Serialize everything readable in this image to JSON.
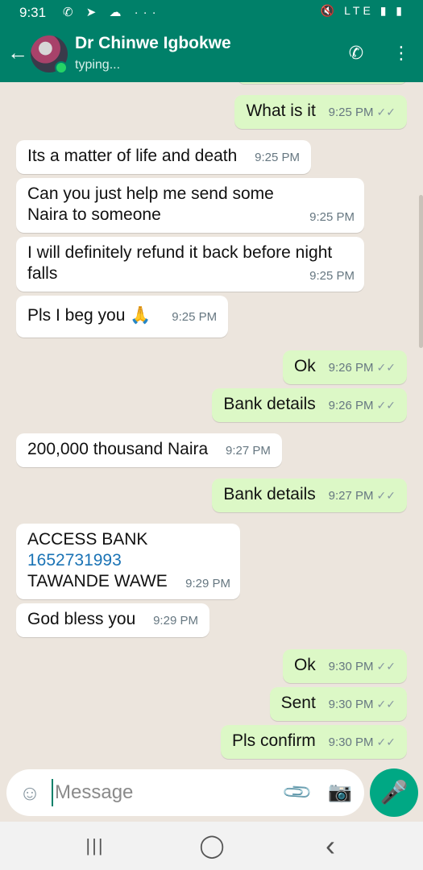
{
  "status_bar": {
    "time": "9:31",
    "left_icons": "✆ ➤ ☁ ···",
    "right_icons": "🔇 LTE ▮ ▮"
  },
  "header": {
    "back_icon": "←",
    "contact_name": "Dr Chinwe Igbokwe",
    "status": "typing...",
    "call_icon": "✆",
    "menu_icon": "⋮"
  },
  "messages": [
    {
      "dir": "out",
      "text": "What is it",
      "time": "9:25 PM",
      "ticks": "✓✓"
    },
    {
      "dir": "in",
      "text": "Its a matter of life and death",
      "time": "9:25 PM"
    },
    {
      "dir": "in",
      "text": "Can you just help me send some Naira to someone",
      "time": "9:25 PM"
    },
    {
      "dir": "in",
      "text": "I will definitely refund it back before night falls",
      "time": "9:25 PM"
    },
    {
      "dir": "in",
      "text": "Pls I beg you 🙏",
      "time": "9:25 PM"
    },
    {
      "dir": "out",
      "text": "Ok",
      "time": "9:26 PM",
      "ticks": "✓✓"
    },
    {
      "dir": "out",
      "text": "Bank details",
      "time": "9:26 PM",
      "ticks": "✓✓"
    },
    {
      "dir": "in",
      "text": "200,000 thousand Naira",
      "time": "9:27 PM"
    },
    {
      "dir": "out",
      "text": "Bank details",
      "time": "9:27 PM",
      "ticks": "✓✓"
    },
    {
      "dir": "in",
      "lines": [
        "ACCESS BANK",
        "1652731993",
        "TAWANDE WAWE"
      ],
      "time": "9:29 PM"
    },
    {
      "dir": "in",
      "text": "God bless you",
      "time": "9:29 PM"
    },
    {
      "dir": "out",
      "text": "Ok",
      "time": "9:30 PM",
      "ticks": "✓✓"
    },
    {
      "dir": "out",
      "text": "Sent",
      "time": "9:30 PM",
      "ticks": "✓✓"
    },
    {
      "dir": "out",
      "text": "Pls confirm",
      "time": "9:30 PM",
      "ticks": "✓✓"
    }
  ],
  "input": {
    "placeholder": "Message",
    "emoji_icon": "☺",
    "attach_icon": "📎",
    "camera_icon": "📷",
    "mic_icon": "🎤"
  },
  "nav": {
    "recents": "|||",
    "home": "◯",
    "back": "‹"
  }
}
